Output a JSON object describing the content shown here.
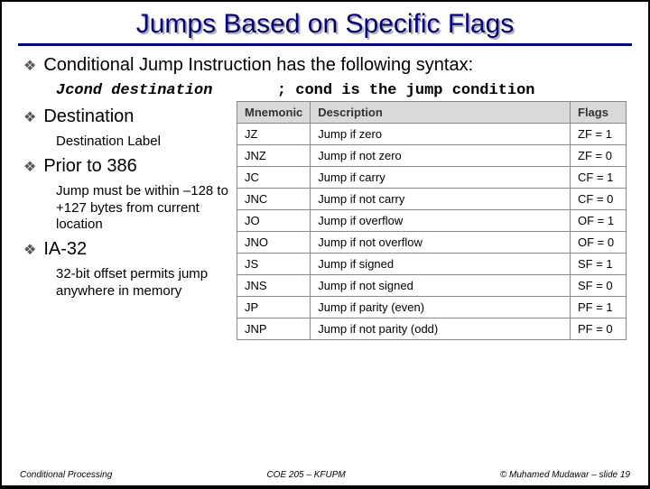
{
  "title": "Jumps Based on Specific Flags",
  "bullet_syntax": "Conditional Jump Instruction has the following syntax:",
  "code_left": "Jcond destination",
  "code_right": "; cond is the jump condition",
  "bullet_dest": "Destination",
  "sub_dest": "Destination Label",
  "bullet_386": "Prior to 386",
  "sub_386": "Jump must be within –128 to +127 bytes from current location",
  "bullet_ia32": "IA-32",
  "sub_ia32": "32-bit offset permits jump anywhere in memory",
  "table": {
    "headers": {
      "h0": "Mnemonic",
      "h1": "Description",
      "h2": "Flags"
    },
    "rows": {
      "r0": {
        "mne": "JZ",
        "desc": "Jump if zero",
        "flag": "ZF = 1"
      },
      "r1": {
        "mne": "JNZ",
        "desc": "Jump if not zero",
        "flag": "ZF = 0"
      },
      "r2": {
        "mne": "JC",
        "desc": "Jump if carry",
        "flag": "CF = 1"
      },
      "r3": {
        "mne": "JNC",
        "desc": "Jump if not carry",
        "flag": "CF = 0"
      },
      "r4": {
        "mne": "JO",
        "desc": "Jump if overflow",
        "flag": "OF = 1"
      },
      "r5": {
        "mne": "JNO",
        "desc": "Jump if not overflow",
        "flag": "OF = 0"
      },
      "r6": {
        "mne": "JS",
        "desc": "Jump if signed",
        "flag": "SF = 1"
      },
      "r7": {
        "mne": "JNS",
        "desc": "Jump if not signed",
        "flag": "SF = 0"
      },
      "r8": {
        "mne": "JP",
        "desc": "Jump if parity (even)",
        "flag": "PF = 1"
      },
      "r9": {
        "mne": "JNP",
        "desc": "Jump if not parity (odd)",
        "flag": "PF = 0"
      }
    }
  },
  "footer": {
    "left": "Conditional Processing",
    "center": "COE 205 – KFUPM",
    "right": "© Muhamed Mudawar – slide 19"
  },
  "chart_data": {
    "type": "table",
    "title": "Jumps Based on Specific Flags",
    "columns": [
      "Mnemonic",
      "Description",
      "Flags"
    ],
    "rows": [
      [
        "JZ",
        "Jump if zero",
        "ZF = 1"
      ],
      [
        "JNZ",
        "Jump if not zero",
        "ZF = 0"
      ],
      [
        "JC",
        "Jump if carry",
        "CF = 1"
      ],
      [
        "JNC",
        "Jump if not carry",
        "CF = 0"
      ],
      [
        "JO",
        "Jump if overflow",
        "OF = 1"
      ],
      [
        "JNO",
        "Jump if not overflow",
        "OF = 0"
      ],
      [
        "JS",
        "Jump if signed",
        "SF = 1"
      ],
      [
        "JNS",
        "Jump if not signed",
        "SF = 0"
      ],
      [
        "JP",
        "Jump if parity (even)",
        "PF = 1"
      ],
      [
        "JNP",
        "Jump if not parity (odd)",
        "PF = 0"
      ]
    ]
  }
}
